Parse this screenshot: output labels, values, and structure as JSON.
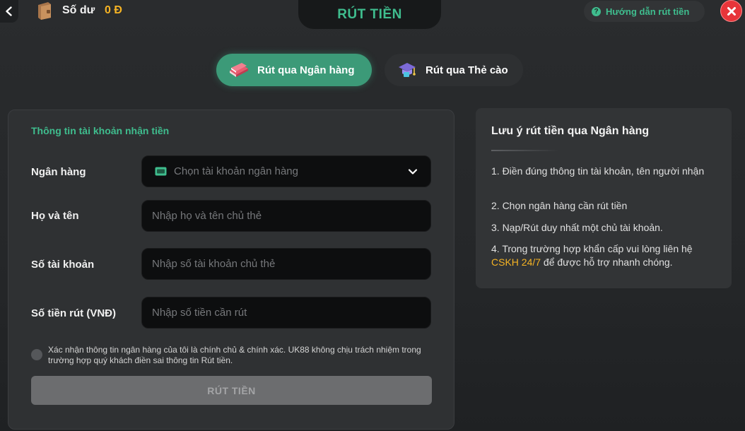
{
  "header": {
    "balance_label": "Số dư",
    "balance_value": "0 Đ",
    "title": "RÚT TIỀN",
    "guide_label": "Hướng dẫn rút tiền",
    "guide_icon": "question-icon",
    "back_icon": "chevron-left-icon",
    "close_icon": "close-icon"
  },
  "methods": [
    {
      "label": "Rút qua Ngân hàng",
      "icon": "books-icon",
      "active": true
    },
    {
      "label": "Rút qua Thẻ cào",
      "icon": "graduation-cap-icon",
      "active": false
    }
  ],
  "form": {
    "section_title": "Thông tin tài khoản nhận tiền",
    "bank_label": "Ngân hàng",
    "bank_placeholder": "Chọn tài khoản ngân hàng",
    "name_label": "Họ và tên",
    "name_placeholder": "Nhập họ và tên chủ thẻ",
    "account_label": "Số tài khoản",
    "account_placeholder": "Nhập số tài khoản chủ thẻ",
    "amount_label": "Số tiền rút (VNĐ)",
    "amount_placeholder": "Nhập số tiền cần rút",
    "confirm_text": "Xác nhận thông tin ngân hàng của tôi là chính chủ & chính xác. UK88 không chịu trách nhiệm trong trường hợp quý khách điền sai thông tin Rút tiền.",
    "submit_label": "RÚT TIỀN"
  },
  "notes": {
    "title": "Lưu ý rút tiền qua Ngân hàng",
    "item1": "1. Điền đúng thông tin tài khoản, tên người nhận",
    "item2": "2. Chọn ngân hàng cần rút tiền",
    "item3": "3. Nạp/Rút duy nhất một chủ tài khoản.",
    "item4_before": "4. Trong trường hợp khẩn cấp vui lòng liên hệ ",
    "item4_link": "CSKH 24/7",
    "item4_after": " để được hỗ trợ nhanh chóng."
  },
  "colors": {
    "accent": "#3fbd8e",
    "balance": "#f5b324",
    "close": "#e7353a",
    "link": "#f5b324"
  }
}
